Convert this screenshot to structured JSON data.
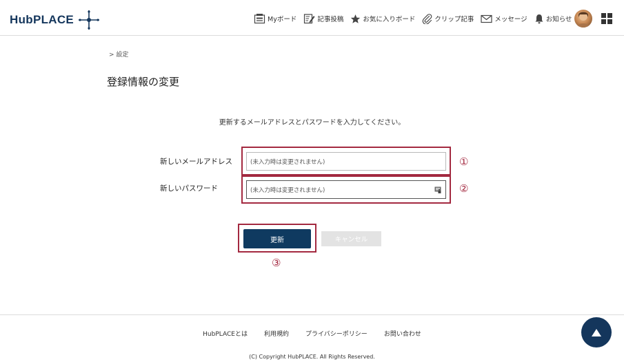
{
  "header": {
    "logo_text": "HubPLACE",
    "nav": [
      {
        "label": "Myボード",
        "icon": "board-icon"
      },
      {
        "label": "記事投稿",
        "icon": "edit-icon"
      },
      {
        "label": "お気に入りボード",
        "icon": "star-icon"
      },
      {
        "label": "クリップ記事",
        "icon": "clip-icon"
      },
      {
        "label": "メッセージ",
        "icon": "mail-icon"
      },
      {
        "label": "お知らせ",
        "icon": "bell-icon"
      }
    ]
  },
  "breadcrumb": "> 設定",
  "page_title": "登録情報の変更",
  "instructions": "更新するメールアドレスとパスワードを入力してください。",
  "form": {
    "email_label": "新しいメールアドレス",
    "email_placeholder": "(未入力時は変更されません)",
    "password_label": "新しいパスワード",
    "password_placeholder": "(未入力時は変更されません)"
  },
  "annotations": {
    "one": "①",
    "two": "②",
    "three": "③",
    "color": "#a3283f"
  },
  "buttons": {
    "update": "更新",
    "cancel": "キャンセル"
  },
  "footer": {
    "links": [
      "HubPLACEとは",
      "利用規約",
      "プライバシーポリシー",
      "お問い合わせ"
    ],
    "copyright": "(C) Copyright HubPLACE. All Rights Reserved."
  },
  "colors": {
    "brand": "#14365c",
    "primary_button": "#0f3a60",
    "cancel_button": "#e3e3e3"
  }
}
